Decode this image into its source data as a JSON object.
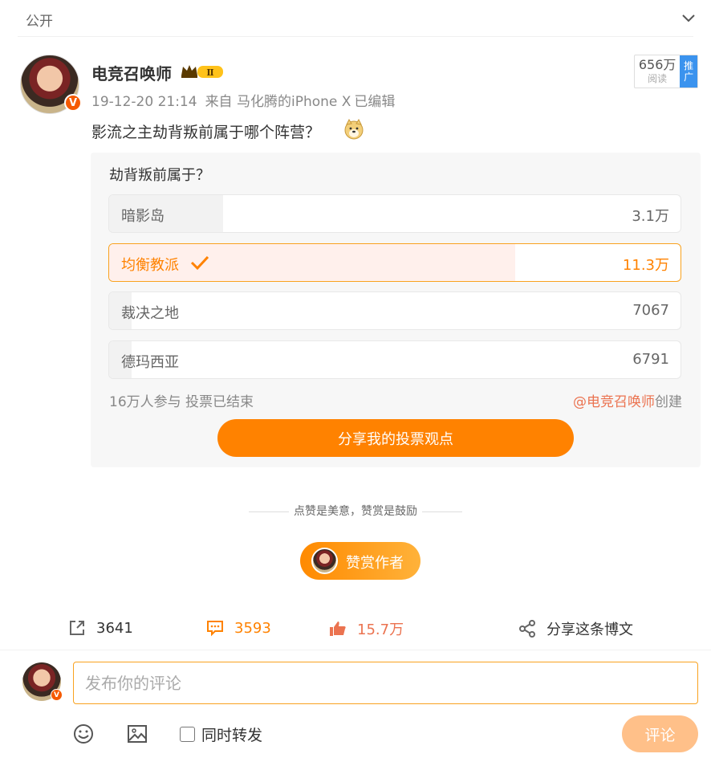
{
  "topbar": {
    "visibility": "公开"
  },
  "post": {
    "author": "电竞召唤师",
    "verified_badge": "V",
    "vip_level": "Ⅱ",
    "timestamp": "19-12-20 21:14",
    "source": "来自 马化腾的iPhone X",
    "edited": "已编辑",
    "reads": "656万",
    "reads_label": "阅读",
    "promo_label": [
      "推",
      "广"
    ],
    "text": "影流之主劫背叛前属于哪个阵营？",
    "emoji": "doge-emoji"
  },
  "poll": {
    "question": "劫背叛前属于？",
    "options": [
      {
        "label": "暗影岛",
        "count": "3.1万",
        "share": 0.2,
        "selected": false
      },
      {
        "label": "均衡教派",
        "count": "11.3万",
        "share": 0.71,
        "selected": true
      },
      {
        "label": "裁决之地",
        "count": "7067",
        "share": 0.04,
        "selected": false
      },
      {
        "label": "德玛西亚",
        "count": "6791",
        "share": 0.04,
        "selected": false
      }
    ],
    "participants": "16万人参与",
    "status": "投票已结束",
    "creator_handle": "@电竞召唤师",
    "creator_suffix": "创建",
    "share_button": "分享我的投票观点"
  },
  "reward": {
    "tip": "点赞是美意，赞赏是鼓励",
    "button": "赞赏作者"
  },
  "actions": {
    "repost_count": "3641",
    "comment_count": "3593",
    "like_count": "15.7万",
    "share_label": "分享这条博文"
  },
  "comment": {
    "placeholder": "发布你的评论",
    "repost_checkbox": "同时转发",
    "submit": "评论"
  },
  "colors": {
    "accent": "#ff8200",
    "link": "#eb7350",
    "selected_fill": "#fff0ec",
    "promo_blue": "#3b93ee"
  }
}
